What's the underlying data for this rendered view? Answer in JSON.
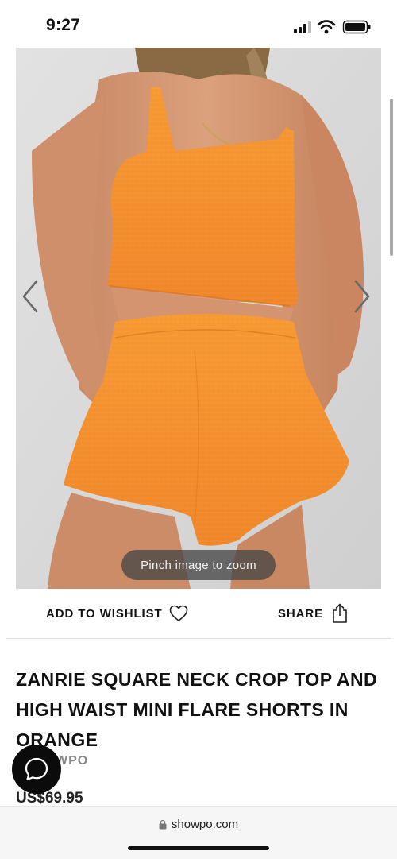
{
  "status_bar": {
    "time": "9:27",
    "icons": [
      "cellular-signal-icon",
      "wifi-icon",
      "battery-icon"
    ]
  },
  "gallery": {
    "image_subject": "model wearing orange square neck crop top and high waist flare shorts",
    "zoom_hint": "Pinch image to zoom",
    "icons": [
      "chevron-left-icon",
      "chevron-right-icon"
    ]
  },
  "actions": {
    "wishlist_label": "ADD TO WISHLIST",
    "share_label": "SHARE",
    "icons": [
      "heart-icon",
      "share-icon"
    ]
  },
  "product": {
    "title": "ZANRIE SQUARE NECK CROP TOP AND HIGH WAIST MINI FLARE SHORTS IN ORANGE",
    "brand_visible": "WPO",
    "price": "US$69.95"
  },
  "chat": {
    "icon": "chat-bubble-icon"
  },
  "browser": {
    "url": "showpo.com",
    "icons": [
      "lock-icon"
    ]
  },
  "colors": {
    "product_orange": "#f5932f",
    "background_gray": "#d9d9d9",
    "text": "#111111"
  }
}
